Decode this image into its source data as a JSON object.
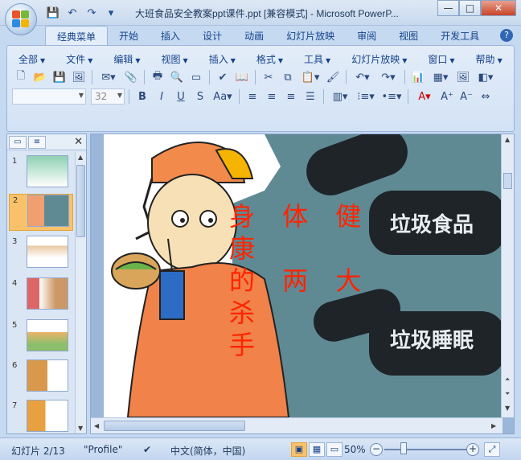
{
  "window": {
    "title": "大班食品安全教案ppt课件.ppt [兼容模式] - Microsoft PowerP...",
    "controls": [
      "—",
      "□",
      "✕"
    ]
  },
  "quick_access": [
    "save-icon",
    "undo-icon",
    "redo-icon",
    "customize-icon"
  ],
  "ribbon_tabs": [
    "经典菜单",
    "开始",
    "插入",
    "设计",
    "动画",
    "幻灯片放映",
    "审阅",
    "视图",
    "开发工具"
  ],
  "menu": [
    "全部",
    "文件",
    "编辑",
    "视图",
    "插入",
    "格式",
    "工具",
    "幻灯片放映",
    "窗口",
    "帮助"
  ],
  "toolbar": {
    "font_name_placeholder": "",
    "font_size": "32"
  },
  "slides": {
    "items": [
      "1",
      "2",
      "3",
      "4",
      "5",
      "6",
      "7"
    ],
    "selected": "2"
  },
  "slide": {
    "title_lines": [
      "身 体 健 康",
      "的 两 大 杀",
      "手"
    ],
    "labels": [
      "垃圾食品",
      "垃圾睡眠"
    ]
  },
  "status": {
    "slide_info": "幻灯片 2/13",
    "theme": "\"Profile\"",
    "language": "中文(简体，中国)",
    "zoom": "50%"
  },
  "colors": {
    "accent": "#15428b",
    "title_red": "#ff2400",
    "slide_bg": "#5f8a94",
    "selected_thumb": "#f9c26a"
  }
}
